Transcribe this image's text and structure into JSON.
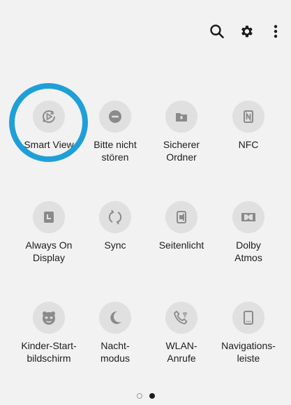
{
  "topbar": {
    "icons": [
      "search-icon",
      "gear-icon",
      "more-vert-icon"
    ]
  },
  "tiles": [
    {
      "label": "Smart View",
      "icon": "smart-view-icon"
    },
    {
      "label": "Bitte nicht\nstören",
      "icon": "do-not-disturb-icon"
    },
    {
      "label": "Sicherer\nOrdner",
      "icon": "secure-folder-icon"
    },
    {
      "label": "NFC",
      "icon": "nfc-icon"
    },
    {
      "label": "Always On\nDisplay",
      "icon": "always-on-display-icon"
    },
    {
      "label": "Sync",
      "icon": "sync-icon"
    },
    {
      "label": "Seitenlicht",
      "icon": "edge-lighting-icon"
    },
    {
      "label": "Dolby\nAtmos",
      "icon": "dolby-icon"
    },
    {
      "label": "Kinder-Start-\nbildschirm",
      "icon": "kids-home-icon"
    },
    {
      "label": "Nacht-\nmodus",
      "icon": "night-mode-icon"
    },
    {
      "label": "WLAN-\nAnrufe",
      "icon": "wifi-calling-icon"
    },
    {
      "label": "Navigations-\nleiste",
      "icon": "navigation-bar-icon"
    }
  ],
  "pager": {
    "pages": 2,
    "current_index": 1
  },
  "colors": {
    "background": "#f2f2f2",
    "tile": "#e0e0e0",
    "icon": "#8a8a8a",
    "highlight": "#1f9fd8"
  }
}
